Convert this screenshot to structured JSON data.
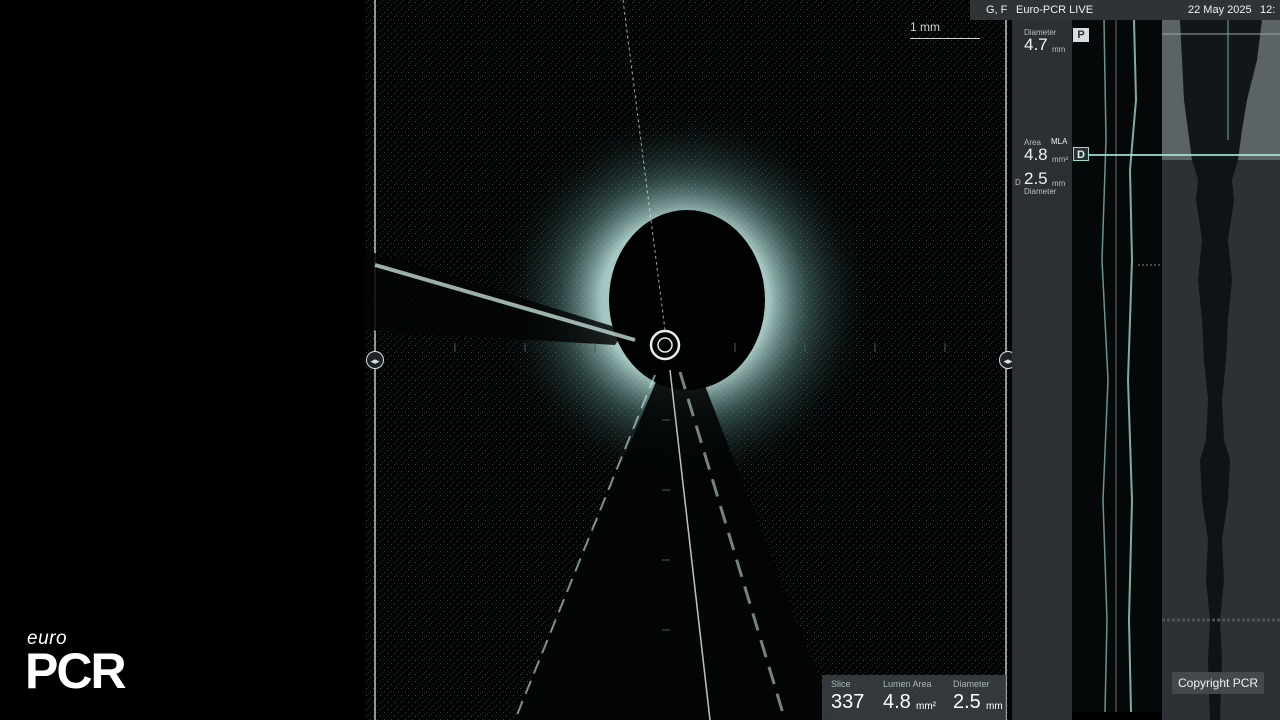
{
  "logo": {
    "line1": "euro",
    "line2": "PCR"
  },
  "header": {
    "patient": "G, F",
    "event": "Euro-PCR LIVE",
    "date": "22 May 2025",
    "time": "12:"
  },
  "scalebar": {
    "label": "1 mm"
  },
  "measurements": {
    "slice_label": "Slice",
    "slice_value": "337",
    "lumen_label": "Lumen Area",
    "lumen_value": "4.8",
    "lumen_unit": "mm²",
    "diameter_label": "Diameter",
    "diameter_value": "2.5",
    "diameter_unit": "mm"
  },
  "side_panel": {
    "prox_label": "Diameter",
    "prox_value": "4.7",
    "prox_unit": "mm",
    "area_label": "Area",
    "mla_label": "MLA",
    "area_value": "4.8",
    "area_unit": "mm²",
    "dist_prefix": "D",
    "dist_value": "2.5",
    "dist_unit": "mm",
    "dist_label": "Diameter"
  },
  "markers": {
    "proximal": "P",
    "distal": "D"
  },
  "copyright": "Copyright PCR",
  "colors": {
    "accent": "#9fe6d6",
    "panel": "#2a3033",
    "background": "#000000"
  }
}
